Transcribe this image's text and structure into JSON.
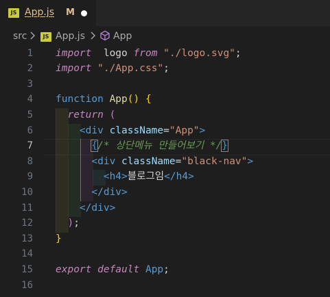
{
  "tab": {
    "title": "App.js",
    "status": "M",
    "badge": "JS"
  },
  "breadcrumb": {
    "folder": "src",
    "file": "App.js",
    "symbol": "App"
  },
  "active_line": 7,
  "lines": [
    {
      "n": "1",
      "t": [
        [
          "kw-c",
          "import"
        ],
        [
          "",
          "  logo "
        ],
        [
          "kw-c",
          "from"
        ],
        [
          "",
          ""
        ],
        [
          "str",
          " \"./logo.svg\""
        ],
        [
          "",
          ";"
        ]
      ]
    },
    {
      "n": "2",
      "t": [
        [
          "kw-c",
          "import"
        ],
        [
          "str",
          " \"./App.css\""
        ],
        [
          "",
          ";"
        ]
      ]
    },
    {
      "n": "3",
      "t": []
    },
    {
      "n": "4",
      "t": [
        [
          "kw",
          "function"
        ],
        [
          "",
          ""
        ],
        [
          "fn",
          " App"
        ],
        [
          "p1",
          "()"
        ],
        [
          "",
          ""
        ],
        [
          "p1",
          " {"
        ]
      ]
    },
    {
      "n": "5",
      "t": [
        [
          "",
          "  "
        ],
        [
          "kw-c",
          "return"
        ],
        [
          "",
          ""
        ],
        [
          "p2",
          " ("
        ]
      ]
    },
    {
      "n": "6",
      "t": [
        [
          "",
          "    "
        ],
        [
          "tag",
          "<div"
        ],
        [
          "attr",
          " className"
        ],
        [
          "",
          "="
        ],
        [
          "str",
          "\"App\""
        ],
        [
          "tag",
          ">"
        ]
      ]
    },
    {
      "n": "7",
      "t": [
        [
          "",
          "      "
        ],
        [
          "p3 box",
          "{"
        ],
        [
          "cmt",
          "/* 상단메뉴 만들어보기 */"
        ],
        [
          "p3 box",
          "}"
        ]
      ]
    },
    {
      "n": "8",
      "t": [
        [
          "",
          "      "
        ],
        [
          "tag",
          "<div"
        ],
        [
          "attr",
          " className"
        ],
        [
          "",
          "="
        ],
        [
          "str",
          "\"black-nav\""
        ],
        [
          "tag",
          ">"
        ]
      ]
    },
    {
      "n": "9",
      "t": [
        [
          "",
          "        "
        ],
        [
          "tag",
          "<h4>"
        ],
        [
          "",
          "블로그임"
        ],
        [
          "tag",
          "</h4>"
        ]
      ]
    },
    {
      "n": "10",
      "t": [
        [
          "",
          "      "
        ],
        [
          "tag",
          "</div>"
        ]
      ]
    },
    {
      "n": "11",
      "t": [
        [
          "",
          "    "
        ],
        [
          "tag",
          "</div>"
        ]
      ]
    },
    {
      "n": "12",
      "t": [
        [
          "",
          "  "
        ],
        [
          "p2",
          ")"
        ],
        [
          "",
          ";"
        ]
      ]
    },
    {
      "n": "13",
      "t": [
        [
          "p1",
          "}"
        ]
      ]
    },
    {
      "n": "14",
      "t": []
    },
    {
      "n": "15",
      "t": [
        [
          "kw-c",
          "export"
        ],
        [
          "",
          ""
        ],
        [
          "kw-c",
          " default"
        ],
        [
          "",
          ""
        ],
        [
          "kw",
          " App"
        ],
        [
          "",
          ";"
        ]
      ]
    },
    {
      "n": "16",
      "t": []
    }
  ]
}
